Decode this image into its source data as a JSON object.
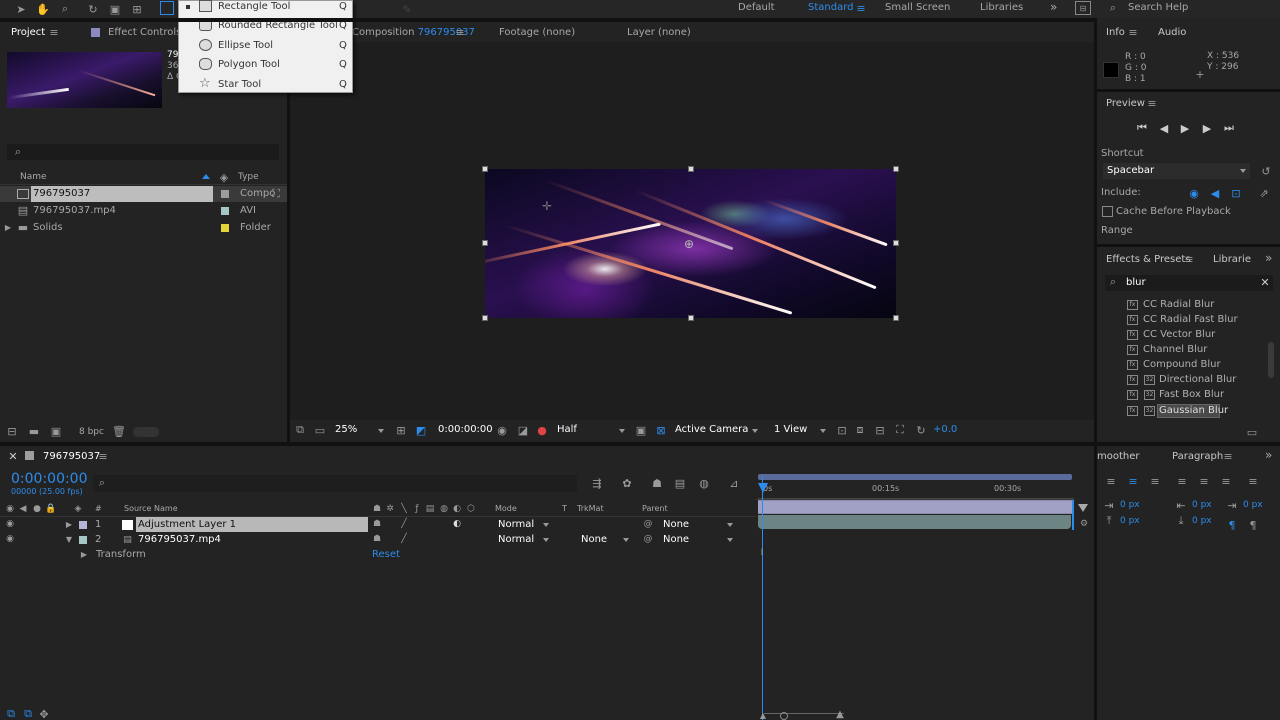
{
  "top_toolbar": {
    "workspaces": [
      "Default",
      "Standard",
      "Small Screen",
      "Libraries"
    ],
    "active_workspace": "Standard",
    "search_placeholder": "Search Help",
    "more": "»"
  },
  "tool_menu": {
    "items": [
      {
        "label": "Rectangle Tool",
        "key": "Q"
      },
      {
        "label": "Rounded Rectangle Tool",
        "key": "Q"
      },
      {
        "label": "Ellipse Tool",
        "key": "Q"
      },
      {
        "label": "Polygon Tool",
        "key": "Q"
      },
      {
        "label": "Star Tool",
        "key": "Q"
      }
    ]
  },
  "project_panel": {
    "tab": "Project",
    "tab2": "Effect Controls A",
    "thumb_info": [
      "79",
      "36",
      "Δ C"
    ],
    "columns": {
      "name": "Name",
      "type": "Type"
    },
    "items": [
      {
        "name": "796795037",
        "type": "Compo",
        "swatch": "#9d9d9d"
      },
      {
        "name": "796795037.mp4",
        "type": "AVI",
        "swatch": "#a7c6c6"
      },
      {
        "name": "Solids",
        "type": "Folder",
        "swatch": "#e3d43a"
      }
    ],
    "bpc": "8 bpc"
  },
  "viewer": {
    "tabs": [
      "Composition",
      "Footage (none)",
      "Layer (none)"
    ],
    "comp_name": "796795037",
    "comp_subtab": "37",
    "zoom": "25%",
    "timecode": "0:00:00:00",
    "resolution": "Half",
    "camera": "Active Camera",
    "views": "1 View",
    "exposure": "+0.0"
  },
  "info_panel": {
    "tab": "Info",
    "tab2": "Audio",
    "r": "R : 0",
    "g": "G : 0",
    "b": "B : 1",
    "x": "X : 536",
    "y": "Y : 296"
  },
  "preview_panel": {
    "tab": "Preview",
    "shortcut_label": "Shortcut",
    "shortcut_value": "Spacebar",
    "include_label": "Include:",
    "cache_label": "Cache Before Playback",
    "range_label": "Range"
  },
  "effects_panel": {
    "tab": "Effects & Presets",
    "tab2": "Librarie",
    "search_value": "blur",
    "items": [
      {
        "label": "CC Radial Blur",
        "two_icons": false
      },
      {
        "label": "CC Radial Fast Blur",
        "two_icons": false
      },
      {
        "label": "CC Vector Blur",
        "two_icons": false
      },
      {
        "label": "Channel Blur",
        "two_icons": false
      },
      {
        "label": "Compound Blur",
        "two_icons": false
      },
      {
        "label": "Directional Blur",
        "two_icons": true
      },
      {
        "label": "Fast Box Blur",
        "two_icons": true
      },
      {
        "label": "Gaussian Blur",
        "two_icons": true
      }
    ],
    "selected": "Gaussian Blur"
  },
  "paragraph_panel": {
    "tab": "Paragraph",
    "tab2": "moother",
    "indent_values": [
      "0 px",
      "0 px",
      "0 px",
      "0 px",
      "0 px"
    ]
  },
  "timeline": {
    "comp_tab": "796795037",
    "timecode": "0:00:00:00",
    "fps": "00000 (25.00 fps)",
    "columns": {
      "hash": "#",
      "source": "Source Name",
      "mode": "Mode",
      "t": "T",
      "trkmat": "TrkMat",
      "parent": "Parent"
    },
    "ruler": [
      "0s",
      "00:15s",
      "00:30s"
    ],
    "layers": [
      {
        "num": "1",
        "name": "Adjustment Layer 1",
        "mode": "Normal",
        "trkmat": "",
        "parent": "None",
        "color": "#b5b5d8"
      },
      {
        "num": "2",
        "name": "796795037.mp4",
        "mode": "Normal",
        "trkmat": "None",
        "parent": "None",
        "color": "#a7c6c6"
      }
    ],
    "transform_label": "Transform",
    "reset_label": "Reset"
  }
}
